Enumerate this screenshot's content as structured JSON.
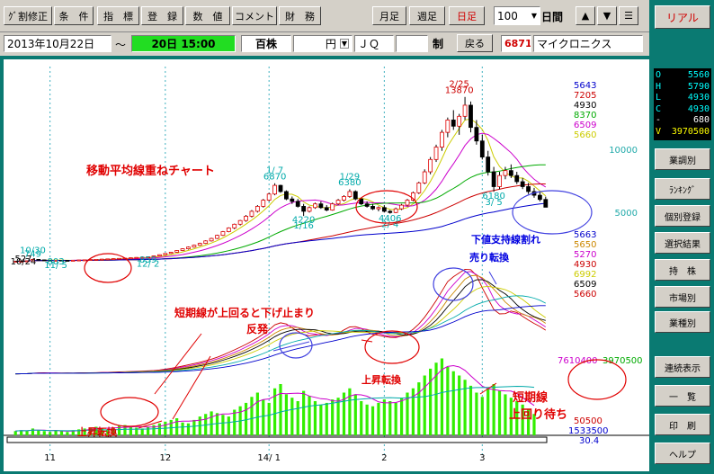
{
  "toolbar": {
    "left_buttons": [
      "ｸﾞ割修正",
      "条　件",
      "指　標",
      "登　録",
      "数　値",
      "コメント",
      "財　務"
    ],
    "period_buttons": [
      "月足",
      "週足",
      "日足"
    ],
    "active_period": "日足",
    "period_count": "100",
    "period_unit": "日間",
    "arrow_up": "▲",
    "arrow_down": "▼",
    "menu": "☰"
  },
  "infobar": {
    "start_date": "2013年10月22日",
    "tilde": "～",
    "end_value": "20日 15:00",
    "unit_label": "百株",
    "currency": "円",
    "market": "ＪＱ",
    "blank_field": "",
    "system": "制",
    "back_button": "戻る",
    "code": "6871",
    "company": "マイクロニクス"
  },
  "sidebar": {
    "real_button": "リアル",
    "ohlc": [
      {
        "label": "O",
        "value": "5560",
        "color": "#00ffff"
      },
      {
        "label": "H",
        "value": "5790",
        "color": "#00ffff"
      },
      {
        "label": "L",
        "value": "4930",
        "color": "#00ffff"
      },
      {
        "label": "C",
        "value": "4930",
        "color": "#00ffff"
      },
      {
        "label": "-",
        "value": "680",
        "color": "#ffffff"
      },
      {
        "label": "V",
        "value": "3970500",
        "color": "#ffff00"
      }
    ],
    "buttons": [
      "業調別",
      "ﾗﾝｷﾝｸﾞ",
      "個別登録",
      "選択結果",
      "持　株",
      "市場別",
      "業種別",
      "連続表示",
      "一　覧",
      "印　刷",
      "ヘルプ"
    ]
  },
  "chart_data": {
    "type": "candlestick",
    "title": "移動平均線重ねチャート",
    "x_tick_labels": [
      "11",
      "12",
      "14/ 1",
      "2",
      "3"
    ],
    "y_tick_labels": [
      "10000",
      "5000"
    ],
    "ylim": [
      0,
      14000
    ],
    "candles": [
      {
        "o": 530,
        "h": 560,
        "l": 510,
        "c": 540
      },
      {
        "o": 540,
        "h": 580,
        "l": 520,
        "c": 560
      },
      {
        "o": 560,
        "h": 600,
        "l": 540,
        "c": 580
      },
      {
        "o": 580,
        "h": 749,
        "l": 560,
        "c": 700
      },
      {
        "o": 700,
        "h": 720,
        "l": 640,
        "c": 660
      },
      {
        "o": 660,
        "h": 680,
        "l": 620,
        "c": 640
      },
      {
        "o": 640,
        "h": 660,
        "l": 600,
        "c": 620
      },
      {
        "o": 620,
        "h": 640,
        "l": 603,
        "c": 630
      },
      {
        "o": 630,
        "h": 650,
        "l": 610,
        "c": 620
      },
      {
        "o": 620,
        "h": 640,
        "l": 600,
        "c": 610
      },
      {
        "o": 610,
        "h": 640,
        "l": 600,
        "c": 630
      },
      {
        "o": 630,
        "h": 660,
        "l": 610,
        "c": 650
      },
      {
        "o": 650,
        "h": 680,
        "l": 630,
        "c": 660
      },
      {
        "o": 660,
        "h": 700,
        "l": 640,
        "c": 690
      },
      {
        "o": 690,
        "h": 720,
        "l": 670,
        "c": 700
      },
      {
        "o": 700,
        "h": 740,
        "l": 680,
        "c": 720
      },
      {
        "o": 720,
        "h": 760,
        "l": 700,
        "c": 740
      },
      {
        "o": 740,
        "h": 780,
        "l": 720,
        "c": 760
      },
      {
        "o": 760,
        "h": 800,
        "l": 740,
        "c": 780
      },
      {
        "o": 780,
        "h": 820,
        "l": 760,
        "c": 800
      },
      {
        "o": 800,
        "h": 850,
        "l": 780,
        "c": 830
      },
      {
        "o": 830,
        "h": 880,
        "l": 810,
        "c": 860
      },
      {
        "o": 860,
        "h": 900,
        "l": 840,
        "c": 880
      },
      {
        "o": 880,
        "h": 920,
        "l": 859,
        "c": 900
      },
      {
        "o": 900,
        "h": 1000,
        "l": 880,
        "c": 980
      },
      {
        "o": 980,
        "h": 1100,
        "l": 960,
        "c": 1080
      },
      {
        "o": 1080,
        "h": 1200,
        "l": 1050,
        "c": 1180
      },
      {
        "o": 1180,
        "h": 1300,
        "l": 1150,
        "c": 1280
      },
      {
        "o": 1280,
        "h": 1450,
        "l": 1250,
        "c": 1420
      },
      {
        "o": 1420,
        "h": 1600,
        "l": 1380,
        "c": 1560
      },
      {
        "o": 1560,
        "h": 1750,
        "l": 1500,
        "c": 1700
      },
      {
        "o": 1700,
        "h": 1900,
        "l": 1650,
        "c": 1850
      },
      {
        "o": 1850,
        "h": 2050,
        "l": 1800,
        "c": 2000
      },
      {
        "o": 2000,
        "h": 2250,
        "l": 1950,
        "c": 2200
      },
      {
        "o": 2200,
        "h": 2450,
        "l": 2150,
        "c": 2400
      },
      {
        "o": 2400,
        "h": 2700,
        "l": 2350,
        "c": 2650
      },
      {
        "o": 2650,
        "h": 3000,
        "l": 2600,
        "c": 2950
      },
      {
        "o": 2950,
        "h": 3300,
        "l": 2900,
        "c": 3250
      },
      {
        "o": 3250,
        "h": 3600,
        "l": 3150,
        "c": 3550
      },
      {
        "o": 3550,
        "h": 3900,
        "l": 3450,
        "c": 3850
      },
      {
        "o": 3850,
        "h": 4300,
        "l": 3750,
        "c": 4200
      },
      {
        "o": 4200,
        "h": 4700,
        "l": 4100,
        "c": 4600
      },
      {
        "o": 4600,
        "h": 5100,
        "l": 4500,
        "c": 5000
      },
      {
        "o": 5000,
        "h": 5600,
        "l": 4900,
        "c": 5500
      },
      {
        "o": 5500,
        "h": 6100,
        "l": 5400,
        "c": 6000
      },
      {
        "o": 6000,
        "h": 6870,
        "l": 5900,
        "c": 6700
      },
      {
        "o": 6700,
        "h": 6750,
        "l": 6100,
        "c": 6200
      },
      {
        "o": 6200,
        "h": 6300,
        "l": 5500,
        "c": 5600
      },
      {
        "o": 5600,
        "h": 5800,
        "l": 5200,
        "c": 5400
      },
      {
        "o": 5400,
        "h": 5600,
        "l": 4900,
        "c": 5000
      },
      {
        "o": 5000,
        "h": 5200,
        "l": 4220,
        "c": 4600
      },
      {
        "o": 4600,
        "h": 5000,
        "l": 4500,
        "c": 4900
      },
      {
        "o": 4900,
        "h": 5300,
        "l": 4800,
        "c": 5200
      },
      {
        "o": 5200,
        "h": 5400,
        "l": 4800,
        "c": 4900
      },
      {
        "o": 4900,
        "h": 5100,
        "l": 4600,
        "c": 4700
      },
      {
        "o": 4700,
        "h": 5300,
        "l": 4650,
        "c": 5200
      },
      {
        "o": 5200,
        "h": 5600,
        "l": 5100,
        "c": 5500
      },
      {
        "o": 5500,
        "h": 5900,
        "l": 5400,
        "c": 5800
      },
      {
        "o": 5800,
        "h": 6380,
        "l": 5700,
        "c": 6200
      },
      {
        "o": 6200,
        "h": 6300,
        "l": 5500,
        "c": 5600
      },
      {
        "o": 5600,
        "h": 5700,
        "l": 5100,
        "c": 5200
      },
      {
        "o": 5200,
        "h": 5400,
        "l": 4900,
        "c": 5000
      },
      {
        "o": 5000,
        "h": 5200,
        "l": 4700,
        "c": 4800
      },
      {
        "o": 4800,
        "h": 5000,
        "l": 4600,
        "c": 4900
      },
      {
        "o": 4900,
        "h": 5100,
        "l": 4500,
        "c": 4600
      },
      {
        "o": 4600,
        "h": 4700,
        "l": 4406,
        "c": 4500
      },
      {
        "o": 4500,
        "h": 4900,
        "l": 4450,
        "c": 4800
      },
      {
        "o": 4800,
        "h": 5200,
        "l": 4700,
        "c": 5100
      },
      {
        "o": 5100,
        "h": 5600,
        "l": 5000,
        "c": 5500
      },
      {
        "o": 5500,
        "h": 6200,
        "l": 5400,
        "c": 6100
      },
      {
        "o": 6100,
        "h": 7000,
        "l": 6000,
        "c": 6900
      },
      {
        "o": 6900,
        "h": 8000,
        "l": 6800,
        "c": 7800
      },
      {
        "o": 7800,
        "h": 9000,
        "l": 7600,
        "c": 8800
      },
      {
        "o": 8800,
        "h": 10000,
        "l": 8600,
        "c": 9800
      },
      {
        "o": 9800,
        "h": 11200,
        "l": 9500,
        "c": 11000
      },
      {
        "o": 11000,
        "h": 12200,
        "l": 10600,
        "c": 12000
      },
      {
        "o": 12000,
        "h": 12800,
        "l": 11200,
        "c": 11500
      },
      {
        "o": 11500,
        "h": 12500,
        "l": 10800,
        "c": 12300
      },
      {
        "o": 12300,
        "h": 13870,
        "l": 12000,
        "c": 13200
      },
      {
        "o": 13200,
        "h": 13500,
        "l": 11000,
        "c": 11400
      },
      {
        "o": 11400,
        "h": 12000,
        "l": 10000,
        "c": 10300
      },
      {
        "o": 10300,
        "h": 10800,
        "l": 8800,
        "c": 9000
      },
      {
        "o": 9000,
        "h": 9500,
        "l": 7500,
        "c": 7800
      },
      {
        "o": 7800,
        "h": 8200,
        "l": 6180,
        "c": 6600
      },
      {
        "o": 6600,
        "h": 7800,
        "l": 6400,
        "c": 7500
      },
      {
        "o": 7500,
        "h": 8200,
        "l": 7200,
        "c": 7900
      },
      {
        "o": 7900,
        "h": 8400,
        "l": 7300,
        "c": 7500
      },
      {
        "o": 7500,
        "h": 7800,
        "l": 6800,
        "c": 7000
      },
      {
        "o": 7000,
        "h": 7300,
        "l": 6400,
        "c": 6600
      },
      {
        "o": 6600,
        "h": 6900,
        "l": 6000,
        "c": 6200
      },
      {
        "o": 6200,
        "h": 6500,
        "l": 5700,
        "c": 5900
      },
      {
        "o": 5900,
        "h": 6200,
        "l": 5400,
        "c": 5560
      },
      {
        "o": 5560,
        "h": 5790,
        "l": 4930,
        "c": 4930
      }
    ],
    "price_labels": [
      {
        "text": "527",
        "i": 0,
        "val": 527,
        "pos": "below"
      },
      {
        "text": "10/24",
        "i": 0,
        "val": 300,
        "pos": "below"
      },
      {
        "text": "10/30",
        "i": 3,
        "val": 1200,
        "pos": "above"
      },
      {
        "text": "749",
        "i": 3,
        "val": 900,
        "pos": "above"
      },
      {
        "text": "803",
        "i": 7,
        "val": 300,
        "pos": "below"
      },
      {
        "text": "11/ 5",
        "i": 7,
        "val": 0,
        "pos": "below"
      },
      {
        "text": "859",
        "i": 23,
        "val": 420,
        "pos": "below"
      },
      {
        "text": "12/ 2",
        "i": 23,
        "val": 100,
        "pos": "below"
      },
      {
        "text": "1/ 7",
        "i": 45,
        "val": 7700,
        "pos": "above"
      },
      {
        "text": "6870",
        "i": 45,
        "val": 7200,
        "pos": "above"
      },
      {
        "text": "4220",
        "i": 50,
        "val": 3700,
        "pos": "below"
      },
      {
        "text": "1/16",
        "i": 50,
        "val": 3200,
        "pos": "below"
      },
      {
        "text": "1/29",
        "i": 58,
        "val": 7200,
        "pos": "above"
      },
      {
        "text": "6380",
        "i": 58,
        "val": 6700,
        "pos": "above"
      },
      {
        "text": "4406",
        "i": 65,
        "val": 3800,
        "pos": "below"
      },
      {
        "text": "2/ 4",
        "i": 65,
        "val": 3300,
        "pos": "below"
      },
      {
        "text": "2/25",
        "i": 77,
        "val": 14700,
        "pos": "above"
      },
      {
        "text": "13870",
        "i": 77,
        "val": 14200,
        "pos": "above"
      },
      {
        "text": "6180",
        "i": 83,
        "val": 5600,
        "pos": "below"
      },
      {
        "text": "3/ 5",
        "i": 83,
        "val": 5100,
        "pos": "below"
      }
    ],
    "ma_right_labels": [
      {
        "text": "5643",
        "color": "#0000cc"
      },
      {
        "text": "7205",
        "color": "#cc0000"
      },
      {
        "text": "4930",
        "color": "#000000"
      },
      {
        "text": "8370",
        "color": "#00aa00"
      },
      {
        "text": "6509",
        "color": "#cc00cc"
      },
      {
        "text": "5660",
        "color": "#cccc00"
      }
    ],
    "lower_right_labels": [
      {
        "text": "5663",
        "color": "#0000cc"
      },
      {
        "text": "5650",
        "color": "#cc8800"
      },
      {
        "text": "5270",
        "color": "#cc00cc"
      },
      {
        "text": "4930",
        "color": "#cc0000"
      },
      {
        "text": "6992",
        "color": "#cccc00"
      },
      {
        "text": "6509",
        "color": "#000000"
      },
      {
        "text": "5660",
        "color": "#cc0000"
      }
    ],
    "volume_labels": [
      {
        "text": "7610400",
        "color": "#cc00cc"
      },
      {
        "text": "3970500",
        "color": "#00aa00"
      },
      {
        "text": "50500",
        "color": "#cc0000"
      },
      {
        "text": "1533500",
        "color": "#0000cc"
      },
      {
        "text": "30.4",
        "color": "#0000cc"
      }
    ],
    "annotations": [
      {
        "text": "移動平均線重ねチャート",
        "color": "#e00000"
      },
      {
        "text": "下値支持線割れ",
        "color": "#0000e0"
      },
      {
        "text": "売り転換",
        "color": "#0000e0"
      },
      {
        "text": "短期線が上回ると下げ止まり",
        "color": "#e00000"
      },
      {
        "text": "反発",
        "color": "#e00000"
      },
      {
        "text": "上昇転換",
        "color": "#e00000"
      },
      {
        "text": "上昇転換",
        "color": "#e00000"
      },
      {
        "text": "短期線",
        "color": "#e00000"
      },
      {
        "text": "上回り待ち",
        "color": "#e00000"
      }
    ],
    "volume": [
      5,
      6,
      5,
      8,
      6,
      5,
      4,
      6,
      5,
      4,
      6,
      7,
      8,
      9,
      10,
      8,
      7,
      9,
      11,
      12,
      10,
      9,
      8,
      10,
      12,
      14,
      16,
      18,
      20,
      15,
      14,
      18,
      22,
      25,
      28,
      26,
      24,
      22,
      30,
      34,
      38,
      45,
      50,
      42,
      38,
      55,
      60,
      48,
      44,
      40,
      52,
      46,
      40,
      36,
      38,
      42,
      44,
      50,
      55,
      48,
      40,
      36,
      34,
      38,
      42,
      40,
      38,
      44,
      50,
      55,
      62,
      70,
      78,
      85,
      90,
      80,
      75,
      70,
      65,
      58,
      50,
      45,
      55,
      60,
      52,
      48,
      44,
      40,
      36,
      30,
      25
    ]
  }
}
